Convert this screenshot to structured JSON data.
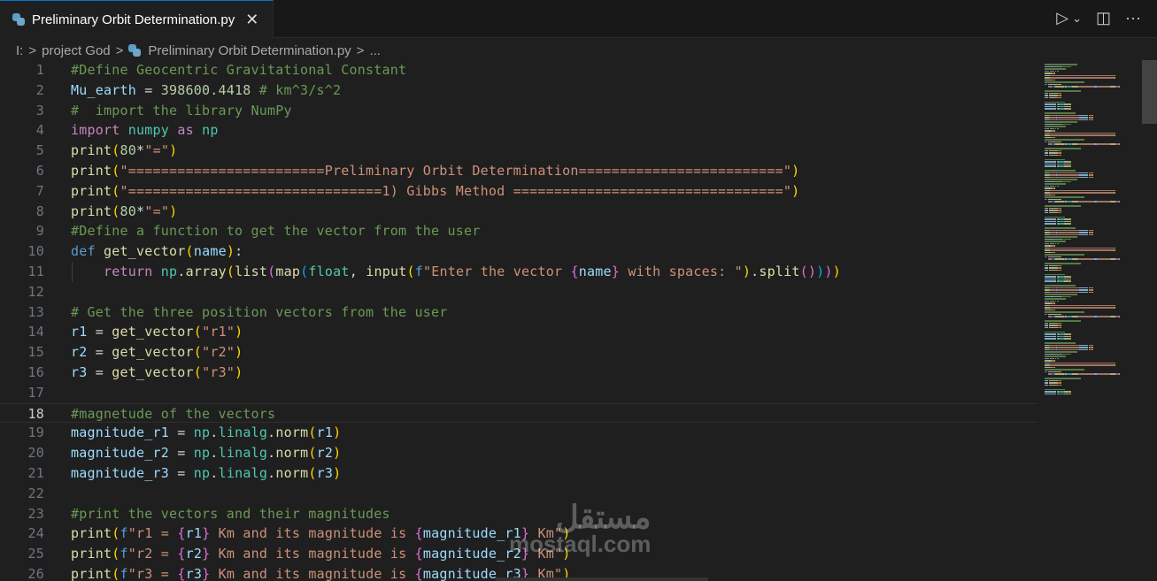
{
  "tab": {
    "icon": "python-icon",
    "title": "Preliminary Orbit Determination.py",
    "close_icon": "close-icon"
  },
  "actions": {
    "run": "▷",
    "run_menu": "⌄",
    "split": "◫",
    "more": "···"
  },
  "breadcrumb": {
    "items": [
      "I:",
      "project God",
      "Preliminary Orbit Determination.py",
      "..."
    ],
    "separator": ">"
  },
  "current_line": 18,
  "colors": {
    "accent": "#0078d4",
    "background": "#1f1f1f",
    "comment": "#6a9955",
    "string": "#ce9178"
  },
  "lines": [
    [
      [
        "comment",
        "#Define Geocentric Gravitational Constant"
      ]
    ],
    [
      [
        "var",
        "Mu_earth"
      ],
      [
        "op",
        " = "
      ],
      [
        "num",
        "398600.4418"
      ],
      [
        "comment",
        " # km^3/s^2"
      ]
    ],
    [
      [
        "comment",
        "#  import the library NumPy"
      ]
    ],
    [
      [
        "kw",
        "import"
      ],
      [
        "op",
        " "
      ],
      [
        "mod",
        "numpy"
      ],
      [
        "op",
        " "
      ],
      [
        "kw",
        "as"
      ],
      [
        "op",
        " "
      ],
      [
        "mod",
        "np"
      ]
    ],
    [
      [
        "fn",
        "print"
      ],
      [
        "b1",
        "("
      ],
      [
        "num",
        "80"
      ],
      [
        "op",
        "*"
      ],
      [
        "str",
        "\"=\""
      ],
      [
        "b1",
        ")"
      ]
    ],
    [
      [
        "fn",
        "print"
      ],
      [
        "b1",
        "("
      ],
      [
        "str",
        "\"========================Preliminary Orbit Determination=========================\""
      ],
      [
        "b1",
        ")"
      ]
    ],
    [
      [
        "fn",
        "print"
      ],
      [
        "b1",
        "("
      ],
      [
        "str",
        "\"===============================1) Gibbs Method =================================\""
      ],
      [
        "b1",
        ")"
      ]
    ],
    [
      [
        "fn",
        "print"
      ],
      [
        "b1",
        "("
      ],
      [
        "num",
        "80"
      ],
      [
        "op",
        "*"
      ],
      [
        "str",
        "\"=\""
      ],
      [
        "b1",
        ")"
      ]
    ],
    [
      [
        "comment",
        "#Define a function to get the vector from the user"
      ]
    ],
    [
      [
        "def",
        "def"
      ],
      [
        "op",
        " "
      ],
      [
        "fn",
        "get_vector"
      ],
      [
        "b1",
        "("
      ],
      [
        "var",
        "name"
      ],
      [
        "b1",
        ")"
      ],
      [
        "op",
        ":"
      ]
    ],
    [
      [
        "op",
        "    "
      ],
      [
        "kw",
        "return"
      ],
      [
        "op",
        " "
      ],
      [
        "mod",
        "np"
      ],
      [
        "op",
        "."
      ],
      [
        "fn",
        "array"
      ],
      [
        "b1",
        "("
      ],
      [
        "fn",
        "list"
      ],
      [
        "b2",
        "("
      ],
      [
        "fn",
        "map"
      ],
      [
        "b3",
        "("
      ],
      [
        "mod",
        "float"
      ],
      [
        "op",
        ", "
      ],
      [
        "fn",
        "input"
      ],
      [
        "b1",
        "("
      ],
      [
        "fstr",
        "f"
      ],
      [
        "str",
        "\"Enter the vector "
      ],
      [
        "b2",
        "{"
      ],
      [
        "var",
        "name"
      ],
      [
        "b2",
        "}"
      ],
      [
        "str",
        " with spaces: \""
      ],
      [
        "b1",
        ")"
      ],
      [
        "op",
        "."
      ],
      [
        "fn",
        "split"
      ],
      [
        "b2",
        "()"
      ],
      [
        "b3",
        ")"
      ],
      [
        "b2",
        ")"
      ],
      [
        "b1",
        ")"
      ]
    ],
    [],
    [
      [
        "comment",
        "# Get the three position vectors from the user"
      ]
    ],
    [
      [
        "var",
        "r1"
      ],
      [
        "op",
        " = "
      ],
      [
        "fn",
        "get_vector"
      ],
      [
        "b1",
        "("
      ],
      [
        "str",
        "\"r1\""
      ],
      [
        "b1",
        ")"
      ]
    ],
    [
      [
        "var",
        "r2"
      ],
      [
        "op",
        " = "
      ],
      [
        "fn",
        "get_vector"
      ],
      [
        "b1",
        "("
      ],
      [
        "str",
        "\"r2\""
      ],
      [
        "b1",
        ")"
      ]
    ],
    [
      [
        "var",
        "r3"
      ],
      [
        "op",
        " = "
      ],
      [
        "fn",
        "get_vector"
      ],
      [
        "b1",
        "("
      ],
      [
        "str",
        "\"r3\""
      ],
      [
        "b1",
        ")"
      ]
    ],
    [],
    [
      [
        "comment",
        "#magnetude of the vectors"
      ]
    ],
    [
      [
        "var",
        "magnitude_r1"
      ],
      [
        "op",
        " = "
      ],
      [
        "mod",
        "np"
      ],
      [
        "op",
        "."
      ],
      [
        "mod",
        "linalg"
      ],
      [
        "op",
        "."
      ],
      [
        "fn",
        "norm"
      ],
      [
        "b1",
        "("
      ],
      [
        "var",
        "r1"
      ],
      [
        "b1",
        ")"
      ]
    ],
    [
      [
        "var",
        "magnitude_r2"
      ],
      [
        "op",
        " = "
      ],
      [
        "mod",
        "np"
      ],
      [
        "op",
        "."
      ],
      [
        "mod",
        "linalg"
      ],
      [
        "op",
        "."
      ],
      [
        "fn",
        "norm"
      ],
      [
        "b1",
        "("
      ],
      [
        "var",
        "r2"
      ],
      [
        "b1",
        ")"
      ]
    ],
    [
      [
        "var",
        "magnitude_r3"
      ],
      [
        "op",
        " = "
      ],
      [
        "mod",
        "np"
      ],
      [
        "op",
        "."
      ],
      [
        "mod",
        "linalg"
      ],
      [
        "op",
        "."
      ],
      [
        "fn",
        "norm"
      ],
      [
        "b1",
        "("
      ],
      [
        "var",
        "r3"
      ],
      [
        "b1",
        ")"
      ]
    ],
    [],
    [
      [
        "comment",
        "#print the vectors and their magnitudes"
      ]
    ],
    [
      [
        "fn",
        "print"
      ],
      [
        "b1",
        "("
      ],
      [
        "fstr",
        "f"
      ],
      [
        "str",
        "\"r1 = "
      ],
      [
        "b2",
        "{"
      ],
      [
        "var",
        "r1"
      ],
      [
        "b2",
        "}"
      ],
      [
        "str",
        " Km and its magnitude is "
      ],
      [
        "b2",
        "{"
      ],
      [
        "var",
        "magnitude_r1"
      ],
      [
        "b2",
        "}"
      ],
      [
        "str",
        " Km\""
      ],
      [
        "b1",
        ")"
      ]
    ],
    [
      [
        "fn",
        "print"
      ],
      [
        "b1",
        "("
      ],
      [
        "fstr",
        "f"
      ],
      [
        "str",
        "\"r2 = "
      ],
      [
        "b2",
        "{"
      ],
      [
        "var",
        "r2"
      ],
      [
        "b2",
        "}"
      ],
      [
        "str",
        " Km and its magnitude is "
      ],
      [
        "b2",
        "{"
      ],
      [
        "var",
        "magnitude_r2"
      ],
      [
        "b2",
        "}"
      ],
      [
        "str",
        " Km\""
      ],
      [
        "b1",
        ")"
      ]
    ],
    [
      [
        "fn",
        "print"
      ],
      [
        "b1",
        "("
      ],
      [
        "fstr",
        "f"
      ],
      [
        "str",
        "\"r3 = "
      ],
      [
        "b2",
        "{"
      ],
      [
        "var",
        "r3"
      ],
      [
        "b2",
        "}"
      ],
      [
        "str",
        " Km and its magnitude is "
      ],
      [
        "b2",
        "{"
      ],
      [
        "var",
        "magnitude_r3"
      ],
      [
        "b2",
        "}"
      ],
      [
        "str",
        " Km\""
      ],
      [
        "b1",
        ")"
      ]
    ]
  ],
  "watermark": {
    "arabic": "مستقل",
    "latin": "mostaql.com"
  }
}
